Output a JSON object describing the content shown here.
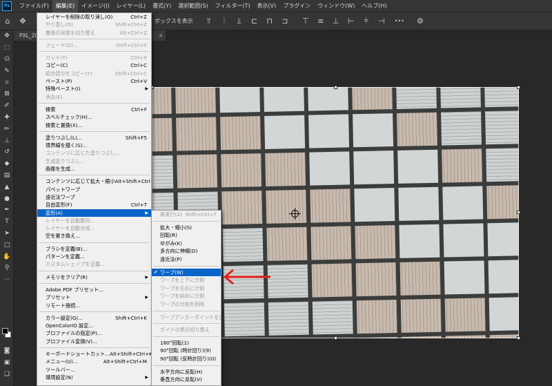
{
  "app": {
    "logo": "Ps"
  },
  "menubar": {
    "items": [
      "ファイル(F)",
      "編集(E)",
      "イメージ(I)",
      "レイヤー(L)",
      "書式(Y)",
      "選択範囲(S)",
      "フィルター(T)",
      "表示(V)",
      "プラグイン",
      "ウィンドウ(W)",
      "ヘルプ(H)"
    ],
    "active_index": 1
  },
  "options_bar": {
    "show_transform_label": "ボックスを表示",
    "more_label": "•••"
  },
  "document": {
    "tab_title": "PXL_20",
    "close": "×"
  },
  "edit_menu": [
    {
      "label": "レイヤーを削除の取り消し(O)",
      "shortcut": "Ctrl+Z"
    },
    {
      "label": "やり直し(O)",
      "shortcut": "Shift+Ctrl+Z",
      "disabled": true
    },
    {
      "label": "最後の状態を切り替え",
      "shortcut": "Alt+Ctrl+Z",
      "disabled": true
    },
    {
      "sep": true
    },
    {
      "label": "フェード(D)...",
      "shortcut": "Shift+Ctrl+F",
      "disabled": true
    },
    {
      "sep": true
    },
    {
      "label": "カット(T)",
      "shortcut": "Ctrl+X",
      "disabled": true
    },
    {
      "label": "コピー(C)",
      "shortcut": "Ctrl+C"
    },
    {
      "label": "結合部分をコピー(Y)",
      "shortcut": "Shift+Ctrl+C",
      "disabled": true
    },
    {
      "label": "ペースト(P)",
      "shortcut": "Ctrl+V"
    },
    {
      "label": "特殊ペースト(I)",
      "submenu": true
    },
    {
      "label": "消去(E)",
      "disabled": true
    },
    {
      "sep": true
    },
    {
      "label": "検索",
      "shortcut": "Ctrl+F"
    },
    {
      "label": "スペルチェック(H)..."
    },
    {
      "label": "検索と置換(X)..."
    },
    {
      "sep": true
    },
    {
      "label": "塗りつぶし(L)...",
      "shortcut": "Shift+F5"
    },
    {
      "label": "境界線を描く(S)..."
    },
    {
      "label": "コンテンツに応じた塗りつぶし...",
      "disabled": true
    },
    {
      "label": "生成塗りつぶし...",
      "disabled": true
    },
    {
      "label": "画像を生成..."
    },
    {
      "sep": true
    },
    {
      "label": "コンテンツに応じて拡大・縮小",
      "shortcut": "Alt+Shift+Ctrl+C"
    },
    {
      "label": "パペットワープ"
    },
    {
      "label": "遠近法ワープ"
    },
    {
      "label": "自由変形(F)",
      "shortcut": "Ctrl+T"
    },
    {
      "label": "変形(A)",
      "submenu": true,
      "highlight": true
    },
    {
      "label": "レイヤーを自動整列...",
      "disabled": true
    },
    {
      "label": "レイヤーを自動合成...",
      "disabled": true
    },
    {
      "label": "空を置き換え..."
    },
    {
      "sep": true
    },
    {
      "label": "ブラシを定義(B)..."
    },
    {
      "label": "パターンを定義..."
    },
    {
      "label": "カスタムシェイプを定義...",
      "disabled": true
    },
    {
      "sep": true
    },
    {
      "label": "メモリをクリア(R)",
      "submenu": true
    },
    {
      "sep": true
    },
    {
      "label": "Adobe PDF プリセット..."
    },
    {
      "label": "プリセット",
      "submenu": true
    },
    {
      "label": "リモート接続..."
    },
    {
      "sep": true
    },
    {
      "label": "カラー設定(G)...",
      "shortcut": "Shift+Ctrl+K"
    },
    {
      "label": "OpenColorIO 設定..."
    },
    {
      "label": "プロファイルの指定(P)..."
    },
    {
      "label": "プロファイル変換(V)..."
    },
    {
      "sep": true
    },
    {
      "label": "キーボードショートカット...",
      "shortcut": "Alt+Shift+Ctrl+K"
    },
    {
      "label": "メニュー(U)...",
      "shortcut": "Alt+Shift+Ctrl+M"
    },
    {
      "label": "ツールバー..."
    },
    {
      "label": "環境設定(N)",
      "submenu": true
    }
  ],
  "transform_submenu": [
    {
      "label": "再実行(A)",
      "shortcut": "Shift+Ctrl+T",
      "disabled": true
    },
    {
      "sep": true
    },
    {
      "label": "拡大・縮小(S)"
    },
    {
      "label": "回転(R)"
    },
    {
      "label": "ゆがみ(K)"
    },
    {
      "label": "多方向に伸縮(D)"
    },
    {
      "label": "遠近法(P)"
    },
    {
      "sep": true
    },
    {
      "label": "ワープ(W)",
      "checked": true,
      "highlight": true
    },
    {
      "label": "ワープを上下に分割",
      "disabled": true
    },
    {
      "label": "ワープを左右に分割",
      "disabled": true
    },
    {
      "label": "ワープを斜めに分割",
      "disabled": true
    },
    {
      "label": "ワープの分割を削除",
      "disabled": true
    },
    {
      "sep": true
    },
    {
      "label": "ワープアンカーポイントを変換",
      "disabled": true
    },
    {
      "sep": true
    },
    {
      "label": "ガイドの表示切り替え",
      "disabled": true
    },
    {
      "sep": true
    },
    {
      "label": "180°回転(1)"
    },
    {
      "label": "90°回転 (時計回り)(9)"
    },
    {
      "label": "90°回転 (反時計回り)(0)"
    },
    {
      "sep": true
    },
    {
      "label": "水平方向に反転(H)"
    },
    {
      "label": "垂直方向に反転(V)"
    }
  ],
  "colors": {
    "menu_highlight": "#0a64c8",
    "annotation_arrow": "#e0201e"
  }
}
